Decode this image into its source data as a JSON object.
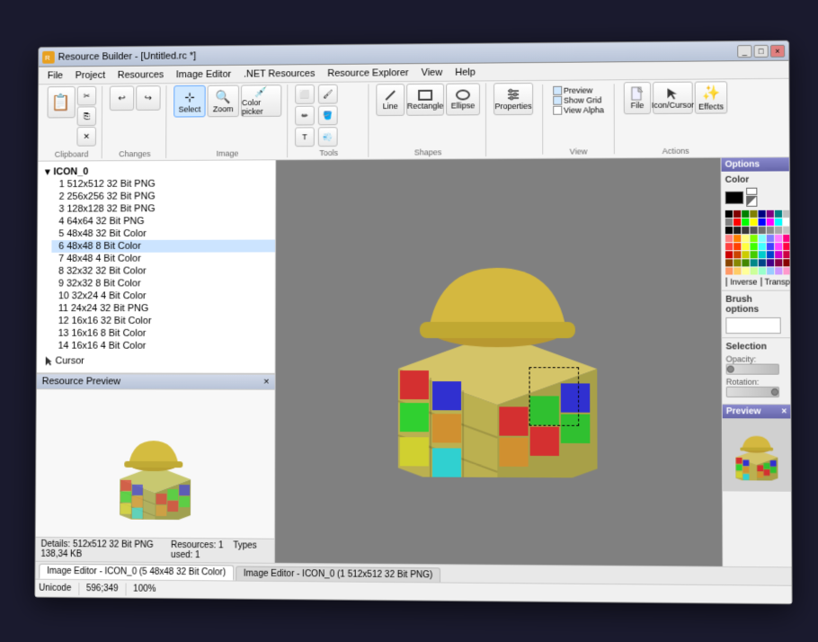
{
  "window": {
    "title": "Resource Builder - [Untitled.rc *]",
    "minimize": "_",
    "maximize": "□",
    "close": "×"
  },
  "menu": {
    "items": [
      "File",
      "Project",
      "Resources",
      "Image Editor",
      ".NET Resources",
      "Resource Explorer",
      "View",
      "Help"
    ]
  },
  "toolbar": {
    "groups": [
      {
        "name": "Clipboard",
        "buttons": [
          "Paste",
          "Cut",
          "Copy",
          "Delete"
        ]
      },
      {
        "name": "Changes",
        "buttons": [
          "Undo",
          "Redo"
        ]
      },
      {
        "name": "Image",
        "buttons": [
          "Select",
          "Zoom",
          "Color picker"
        ]
      },
      {
        "name": "Tools",
        "buttons": [
          "Eraser",
          "Pencil",
          "Text",
          "Brush",
          "Bucket",
          "Spray"
        ]
      },
      {
        "name": "Shapes",
        "buttons": [
          "Line",
          "Rectangle",
          "Ellipse"
        ]
      },
      {
        "name": "",
        "buttons": [
          "Properties"
        ]
      },
      {
        "name": "View",
        "checkboxes": [
          "Preview",
          "Show Grid",
          "View Alpha"
        ]
      },
      {
        "name": "",
        "buttons": [
          "File",
          "Icon/Cursor",
          "Effects"
        ]
      }
    ]
  },
  "tree": {
    "root": "ICON_0",
    "items": [
      {
        "id": 1,
        "label": "1 512x512 32 Bit PNG",
        "selected": false
      },
      {
        "id": 2,
        "label": "2 256x256 32 Bit PNG",
        "selected": false
      },
      {
        "id": 3,
        "label": "3 128x128 32 Bit PNG",
        "selected": false
      },
      {
        "id": 4,
        "label": "4 64x64 32 Bit PNG",
        "selected": false
      },
      {
        "id": 5,
        "label": "5 48x48 32 Bit Color",
        "selected": false
      },
      {
        "id": 6,
        "label": "6 48x48 8 Bit Color",
        "selected": false
      },
      {
        "id": 7,
        "label": "7 48x48 4 Bit Color",
        "selected": false
      },
      {
        "id": 8,
        "label": "8 32x32 32 Bit Color",
        "selected": false
      },
      {
        "id": 9,
        "label": "9 32x32 8 Bit Color",
        "selected": false
      },
      {
        "id": 10,
        "label": "10 32x24 4 Bit Color",
        "selected": false
      },
      {
        "id": 11,
        "label": "11 24x24 32 Bit PNG",
        "selected": false
      },
      {
        "id": 12,
        "label": "12 16x16 32 Bit Color",
        "selected": false
      },
      {
        "id": 13,
        "label": "13 16x16 8 Bit Color",
        "selected": false
      },
      {
        "id": 14,
        "label": "14 16x16 4 Bit Color",
        "selected": false
      }
    ],
    "cursor_item": "Cursor"
  },
  "resource_preview": {
    "title": "Resource Preview",
    "details_label": "Details:",
    "details_value": "512x512 32 Bit PNG 138,34 KB",
    "resources_label": "Resources: 1",
    "types_label": "Types used: 1"
  },
  "options_panel": {
    "title": "Options",
    "color_section": "Color",
    "inverse_label": "Inverse",
    "transparent_label": "Transparent",
    "brush_options": "Brush options",
    "selection_section": "Selection",
    "opacity_label": "Opacity:",
    "rotation_label": "Rotation:",
    "preview_section": "Preview"
  },
  "status_bar": {
    "unicode_label": "Unicode",
    "coordinates": "596;349",
    "zoom": "100%"
  },
  "tabs": [
    {
      "label": "Image Editor - ICON_0 (5 48x48 32 Bit Color)",
      "active": true
    },
    {
      "label": "Image Editor - ICON_0 (1 512x512 32 Bit PNG)",
      "active": false
    }
  ],
  "color_palette": [
    "#000000",
    "#800000",
    "#008000",
    "#808000",
    "#000080",
    "#800080",
    "#008080",
    "#c0c0c0",
    "#808080",
    "#ff0000",
    "#00ff00",
    "#ffff00",
    "#0000ff",
    "#ff00ff",
    "#00ffff",
    "#ffffff",
    "#000000",
    "#1c1c1c",
    "#383838",
    "#545454",
    "#707070",
    "#8c8c8c",
    "#a8a8a8",
    "#c4c4c4",
    "#ff8080",
    "#ff8000",
    "#ffff80",
    "#80ff00",
    "#80ffff",
    "#8080ff",
    "#ff80ff",
    "#ff0080",
    "#ff4040",
    "#ff4000",
    "#ffff40",
    "#40ff00",
    "#40ffff",
    "#4040ff",
    "#ff40ff",
    "#ff0040",
    "#cc0000",
    "#cc4400",
    "#cccc00",
    "#44cc00",
    "#00cccc",
    "#0044cc",
    "#cc00cc",
    "#cc0044",
    "#884400",
    "#888800",
    "#448800",
    "#008888",
    "#004488",
    "#440088",
    "#880044",
    "#880000",
    "#ff9966",
    "#ffcc66",
    "#ffff99",
    "#ccff99",
    "#99ffcc",
    "#99ccff",
    "#cc99ff",
    "#ff99cc"
  ]
}
